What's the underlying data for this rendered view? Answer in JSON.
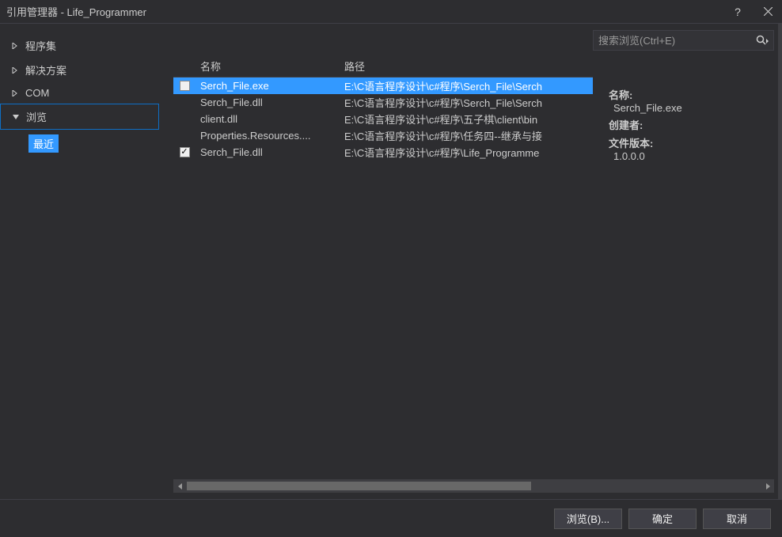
{
  "title": "引用管理器 - Life_Programmer",
  "sidebar": {
    "items": [
      {
        "label": "程序集",
        "expanded": false
      },
      {
        "label": "解决方案",
        "expanded": false
      },
      {
        "label": "COM",
        "expanded": false
      },
      {
        "label": "浏览",
        "expanded": true
      }
    ],
    "sub_recent": "最近"
  },
  "search": {
    "placeholder": "搜索浏览(Ctrl+E)"
  },
  "columns": {
    "name": "名称",
    "path": "路径"
  },
  "rows": [
    {
      "checked": false,
      "show_check": true,
      "selected": true,
      "name": "Serch_File.exe",
      "path": "E:\\C语言程序设计\\c#程序\\Serch_File\\Serch"
    },
    {
      "checked": false,
      "show_check": false,
      "selected": false,
      "name": "Serch_File.dll",
      "path": "E:\\C语言程序设计\\c#程序\\Serch_File\\Serch"
    },
    {
      "checked": false,
      "show_check": false,
      "selected": false,
      "name": "client.dll",
      "path": "E:\\C语言程序设计\\c#程序\\五子棋\\client\\bin"
    },
    {
      "checked": false,
      "show_check": false,
      "selected": false,
      "name": "Properties.Resources....",
      "path": "E:\\C语言程序设计\\c#程序\\任务四--继承与接"
    },
    {
      "checked": true,
      "show_check": true,
      "selected": false,
      "name": "Serch_File.dll",
      "path": "E:\\C语言程序设计\\c#程序\\Life_Programme"
    }
  ],
  "details": {
    "name_label": "名称:",
    "name_value": "Serch_File.exe",
    "creator_label": "创建者:",
    "creator_value": "",
    "version_label": "文件版本:",
    "version_value": "1.0.0.0"
  },
  "footer": {
    "browse": "浏览(B)...",
    "ok": "确定",
    "cancel": "取消"
  }
}
